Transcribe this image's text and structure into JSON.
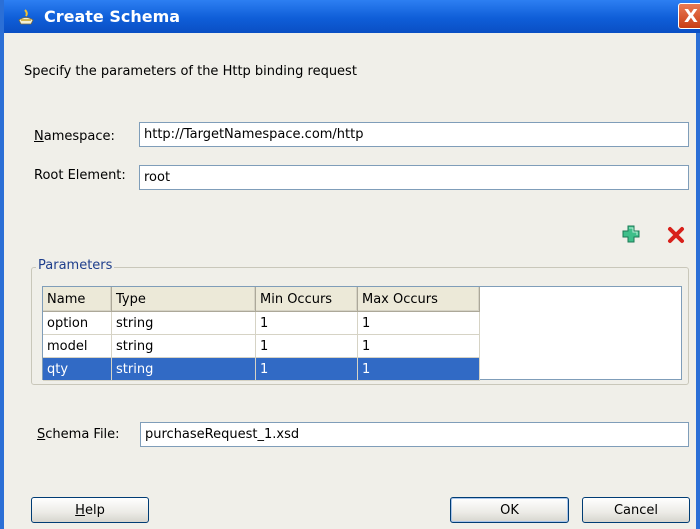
{
  "window": {
    "title": "Create Schema",
    "close_symbol": "X"
  },
  "instructions": "Specify the parameters of the Http binding request",
  "namespace": {
    "label_prefix": "N",
    "label_rest": "amespace:",
    "value": "http://TargetNamespace.com/http"
  },
  "root_element": {
    "label": "Root Element:",
    "value": "root"
  },
  "toolbar": {
    "add_icon": "green-plus-icon",
    "remove_icon": "red-x-icon"
  },
  "parameters": {
    "group_label": "Parameters",
    "columns": [
      "Name",
      "Type",
      "Min Occurs",
      "Max Occurs"
    ],
    "rows": [
      {
        "name": "option",
        "type": "string",
        "min": "1",
        "max": "1",
        "selected": false
      },
      {
        "name": "model",
        "type": "string",
        "min": "1",
        "max": "1",
        "selected": false
      },
      {
        "name": "qty",
        "type": "string",
        "min": "1",
        "max": "1",
        "selected": true
      }
    ]
  },
  "schema_file": {
    "label_prefix": "S",
    "label_rest": "chema File:",
    "value": "purchaseRequest_1.xsd"
  },
  "buttons": {
    "help_prefix": "H",
    "help_rest": "elp",
    "ok": "OK",
    "cancel": "Cancel"
  },
  "colors": {
    "titlebar": "#0f5ed8",
    "selection": "#316ac5",
    "group_label": "#1e3e8c"
  }
}
